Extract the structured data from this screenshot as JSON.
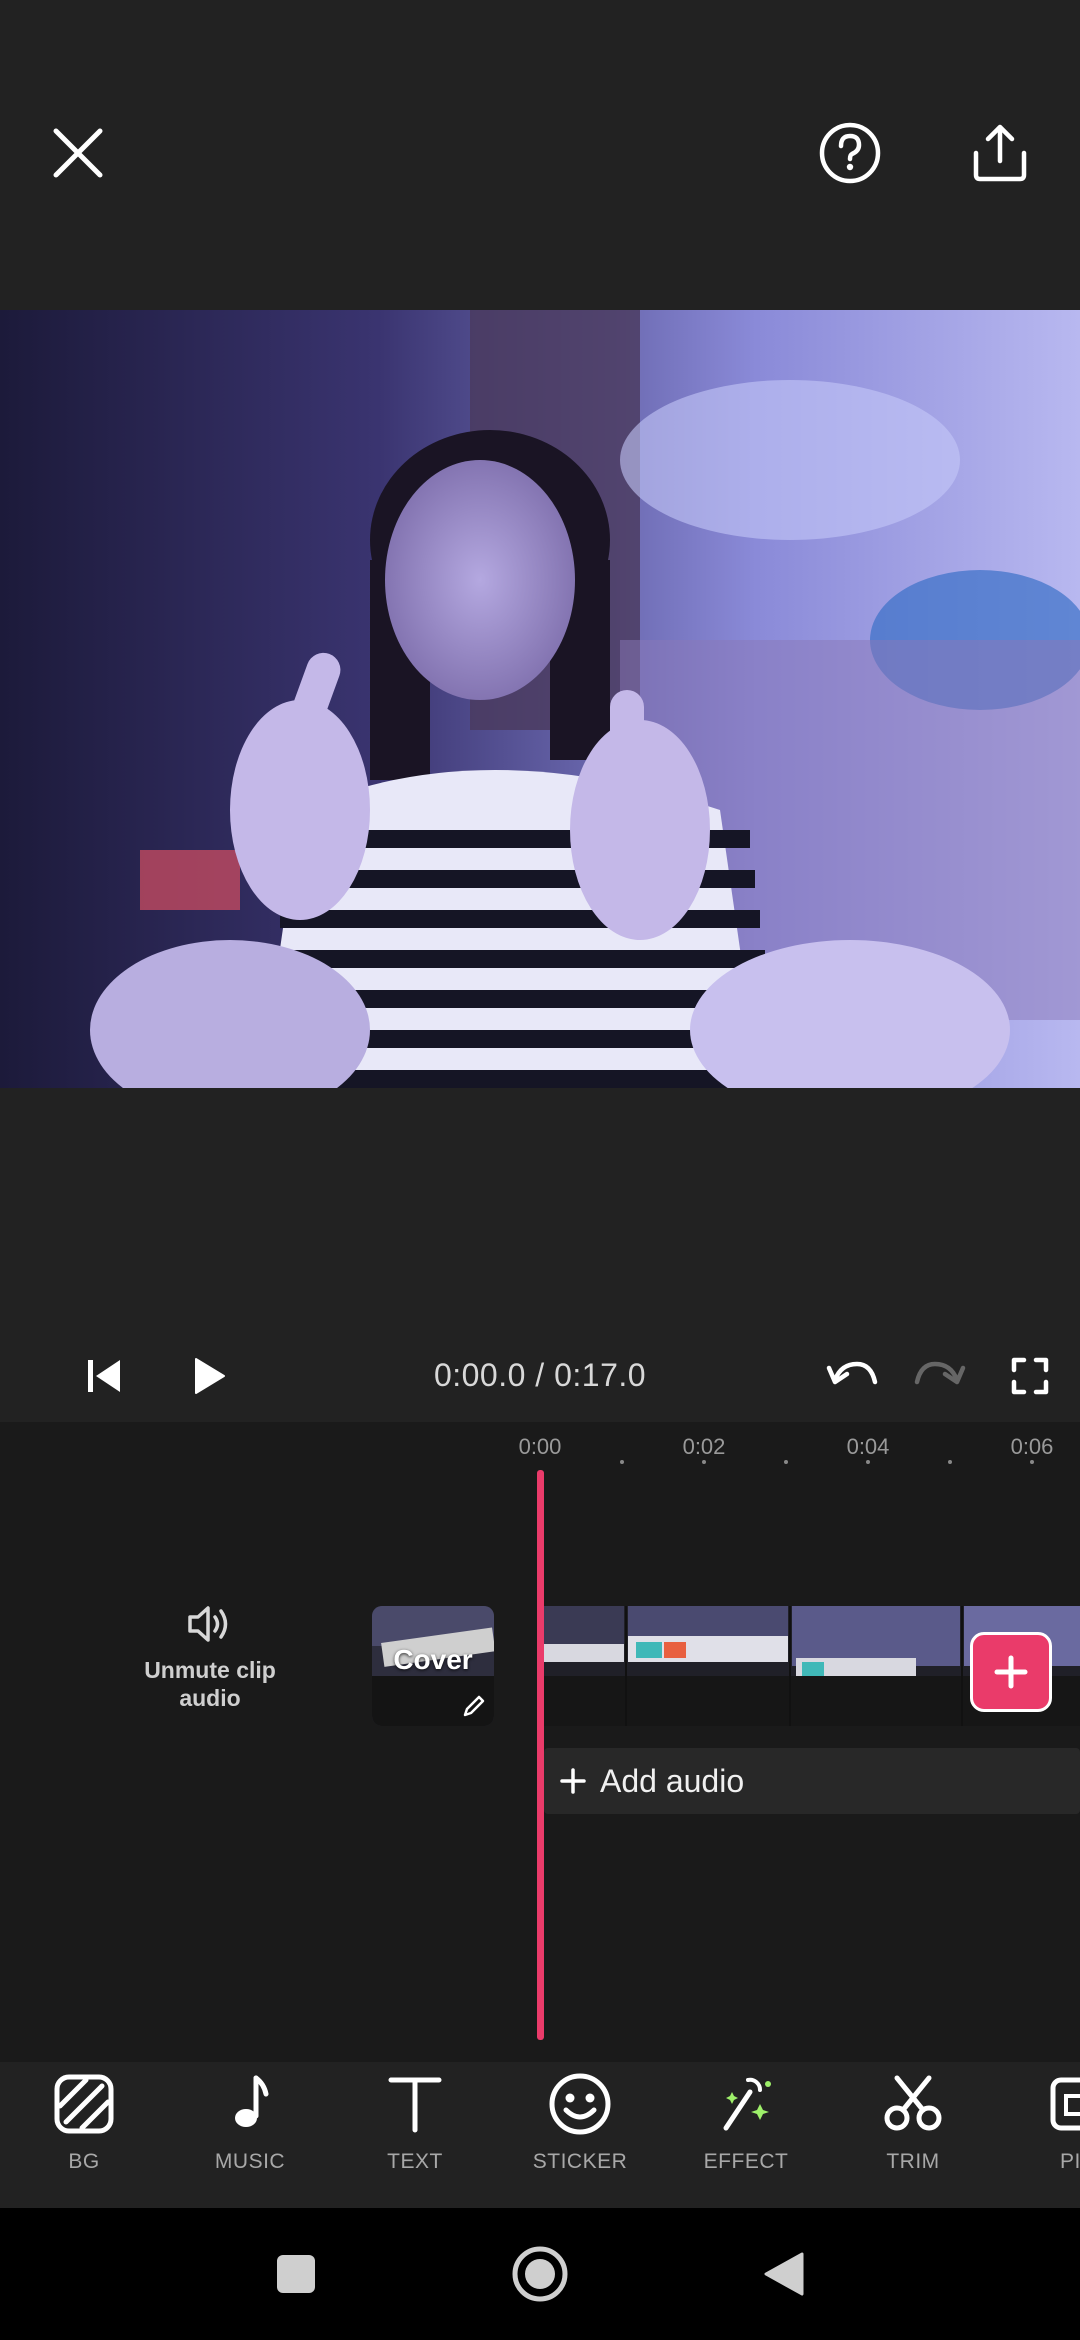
{
  "header": {
    "close_icon": "close-icon",
    "help_icon": "help-circle-icon",
    "share_icon": "share-upload-icon"
  },
  "transport": {
    "time": "0:00.0 / 0:17.0",
    "icons": [
      "skip-to-start-icon",
      "play-icon",
      "undo-icon",
      "redo-icon",
      "fullscreen-icon"
    ]
  },
  "timeline": {
    "ruler": [
      "0:00",
      "0:02",
      "0:04",
      "0:06"
    ],
    "unmute_label_line1": "Unmute clip",
    "unmute_label_line2": "audio",
    "cover_label": "Cover",
    "add_audio_label": "Add audio"
  },
  "tools": [
    {
      "label": "BG",
      "icon": "background-icon"
    },
    {
      "label": "MUSIC",
      "icon": "music-note-icon"
    },
    {
      "label": "TEXT",
      "icon": "text-icon"
    },
    {
      "label": "STICKER",
      "icon": "smiley-icon"
    },
    {
      "label": "EFFECT",
      "icon": "magic-wand-icon"
    },
    {
      "label": "TRIM",
      "icon": "scissors-icon"
    },
    {
      "label": "PI",
      "icon": "pip-icon"
    }
  ],
  "colors": {
    "accent": "#ea3b6a",
    "background": "#222222",
    "timeline_bg": "#1a1a1a"
  }
}
